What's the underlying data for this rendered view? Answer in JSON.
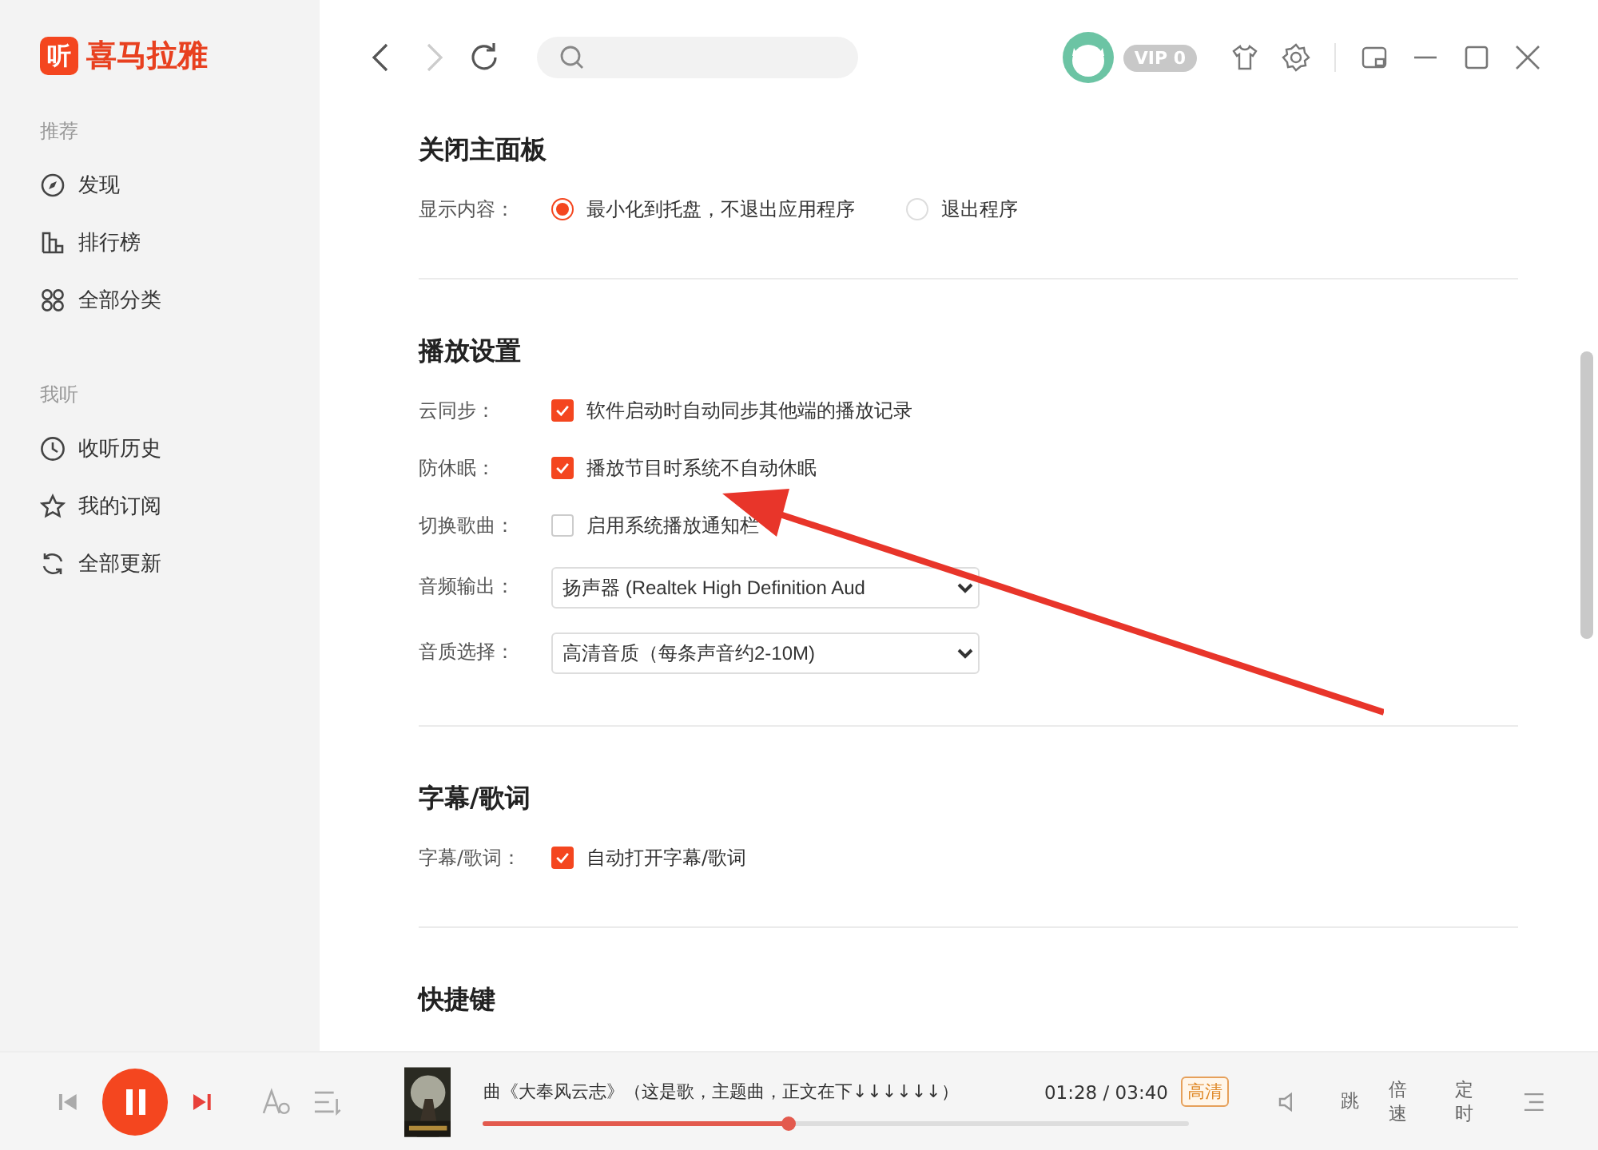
{
  "app": {
    "logo_glyph": "听",
    "name": "喜马拉雅"
  },
  "sidebar": {
    "groups": [
      {
        "title": "推荐",
        "items": [
          {
            "label": "发现",
            "selected": false
          },
          {
            "label": "排行榜",
            "selected": false
          },
          {
            "label": "全部分类",
            "selected": false
          }
        ]
      },
      {
        "title": "我听",
        "items": [
          {
            "label": "收听历史",
            "selected": false
          },
          {
            "label": "我的订阅",
            "selected": false
          },
          {
            "label": "全部更新",
            "selected": false
          }
        ]
      }
    ]
  },
  "toolbar": {
    "forward_disabled": true,
    "vip_badge": "VIP 0"
  },
  "settings": [
    {
      "title": "关闭主面板",
      "rows": [
        {
          "label": "显示内容：",
          "kind": "radio",
          "options": [
            {
              "text": "最小化到托盘，不退出应用程序",
              "selected": true
            },
            {
              "text": "退出程序",
              "selected": false
            }
          ]
        }
      ]
    },
    {
      "title": "播放设置",
      "rows": [
        {
          "label": "云同步：",
          "kind": "checkbox",
          "text": "软件启动时自动同步其他端的播放记录",
          "checked": true
        },
        {
          "label": "防休眠：",
          "kind": "checkbox",
          "text": "播放节目时系统不自动休眠",
          "checked": true
        },
        {
          "label": "切换歌曲：",
          "kind": "checkbox",
          "text": "启用系统播放通知栏",
          "checked": false
        },
        {
          "label": "音频输出：",
          "kind": "select",
          "value": "扬声器 (Realtek High Definition Aud"
        },
        {
          "label": "音质选择：",
          "kind": "select",
          "value": "高清音质（每条声音约2-10M)"
        }
      ]
    },
    {
      "title": "字幕/歌词",
      "rows": [
        {
          "label": "字幕/歌词：",
          "kind": "checkbox",
          "text": "自动打开字幕/歌词",
          "checked": true
        }
      ]
    },
    {
      "title": "快捷键"
    }
  ],
  "annotation_arrow": true,
  "player": {
    "playing": true,
    "title": "曲《大奉风云志》（这是歌，主题曲，正文在下↓↓↓↓↓↓）",
    "level": 0.43,
    "time": "01:28 / 03:40",
    "quality": "高清",
    "skip": "跳",
    "speed": "倍速",
    "timer": "定时"
  }
}
